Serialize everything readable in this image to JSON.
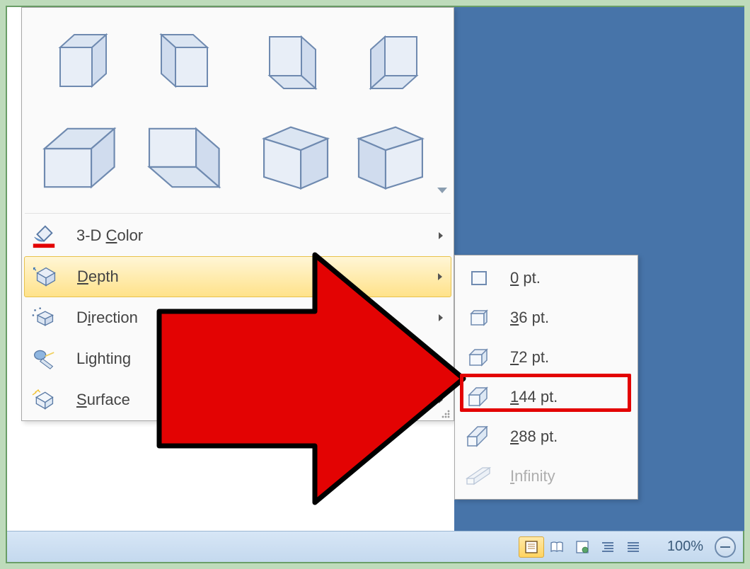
{
  "menu": {
    "color": {
      "label_pre": "3-D ",
      "label_ul": "C",
      "label_post": "olor"
    },
    "depth": {
      "label_ul": "D",
      "label_post": "epth"
    },
    "direction": {
      "label_pre": "D",
      "label_ul": "i",
      "label_post": "rection"
    },
    "lighting": {
      "label_pre": "Li",
      "label_ul": "g",
      "label_post": "hting"
    },
    "surface": {
      "label_ul": "S",
      "label_post": "urface"
    }
  },
  "depth_submenu": {
    "items": [
      {
        "ul": "0",
        "post": " pt."
      },
      {
        "ul": "3",
        "post": "6 pt."
      },
      {
        "ul": "7",
        "post": "2 pt."
      },
      {
        "ul": "1",
        "post": "44 pt."
      },
      {
        "ul": "2",
        "post": "88 pt."
      },
      {
        "ul": "I",
        "post": "nfinity",
        "disabled": true
      }
    ]
  },
  "statusbar": {
    "zoom": "100%"
  },
  "colors": {
    "accent_blue": "#4774a9",
    "highlight_yellow": "#ffe28a",
    "arrow_red": "#e30303"
  }
}
